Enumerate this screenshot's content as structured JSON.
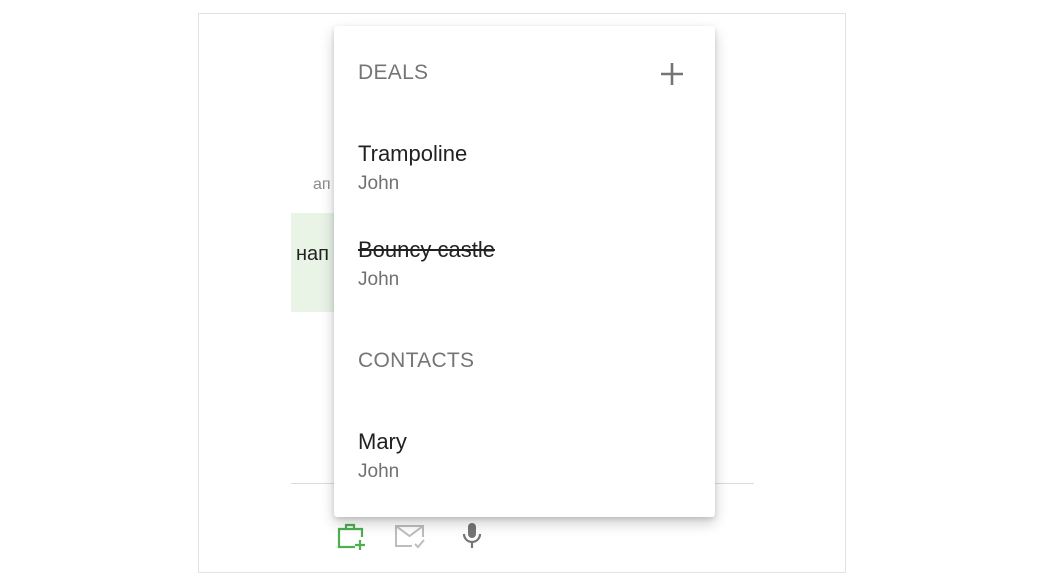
{
  "background": {
    "fragment_top": "ап",
    "fragment_bubble": "нап"
  },
  "menu": {
    "deals_header": "DEALS",
    "deals": [
      {
        "title": "Trampoline",
        "subtitle": "John",
        "completed": false
      },
      {
        "title": "Bouncy castle",
        "subtitle": "John",
        "completed": true
      }
    ],
    "contacts_header": "CONTACTS",
    "contacts": [
      {
        "title": "Mary",
        "subtitle": "John"
      }
    ],
    "icons": {
      "add": "plus-icon"
    }
  },
  "toolbar": {
    "icons": [
      "briefcase-add-icon",
      "mail-check-icon",
      "microphone-icon"
    ]
  },
  "colors": {
    "accent_green": "#4caf50",
    "bubble_bg": "#e9f3e6",
    "header_gray": "#757575"
  }
}
